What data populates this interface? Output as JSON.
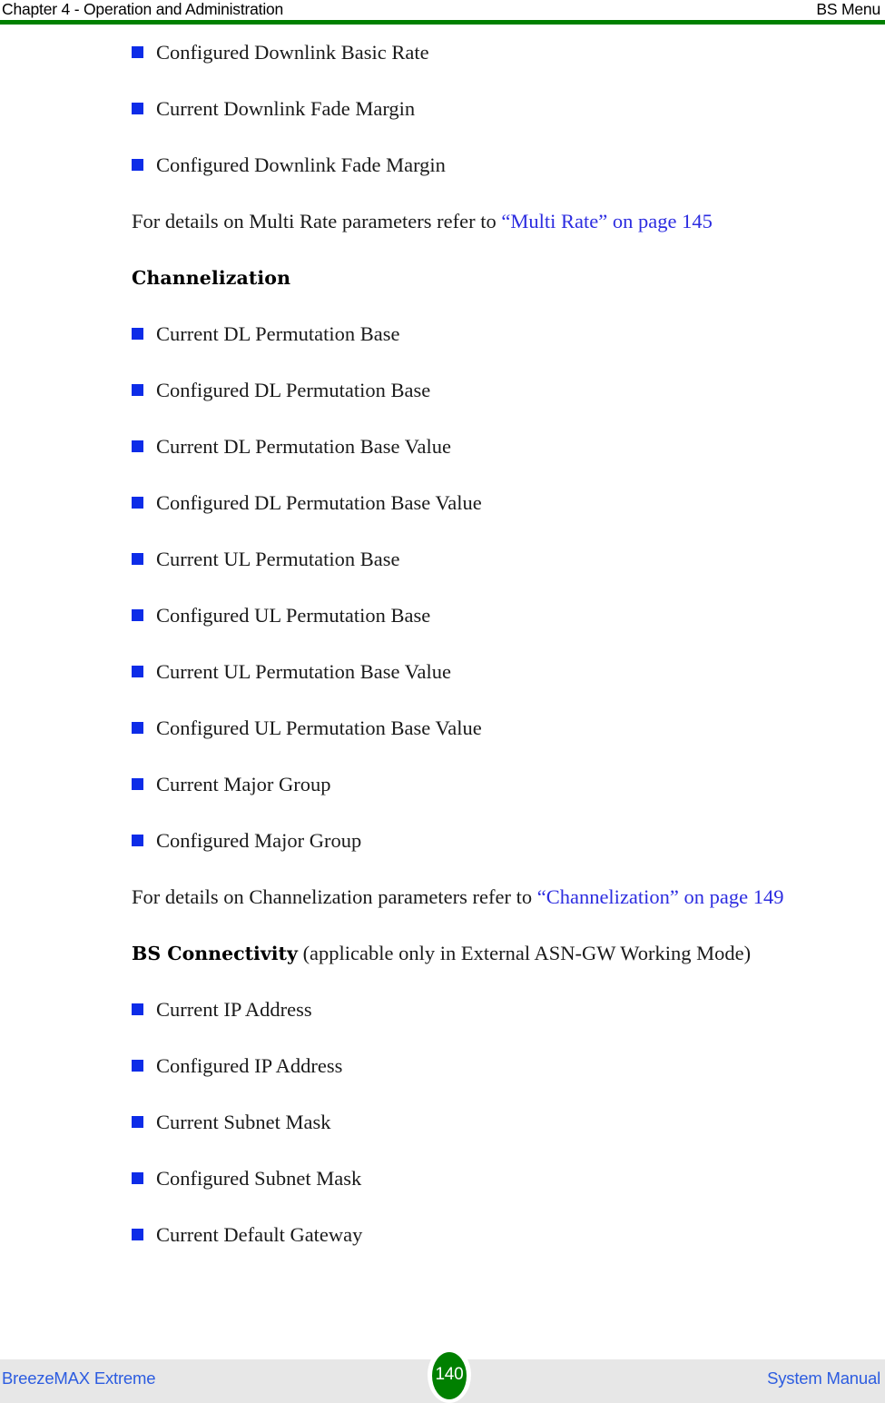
{
  "header": {
    "left_text": "Chapter 4 - Operation and Administration",
    "right_text": "BS Menu",
    "rule_color": "#008000"
  },
  "colors": {
    "bullet_blue": "#0d2ce8",
    "link_blue": "#2c2ce0",
    "footer_text_blue": "#2c5ce0",
    "footer_band": "#e7e7e7",
    "accent_green": "#008000"
  },
  "body": {
    "blocks": [
      {
        "type": "bullet",
        "label": "Configured Downlink Basic Rate"
      },
      {
        "type": "bullet",
        "label": "Current Downlink Fade Margin"
      },
      {
        "type": "bullet",
        "label": "Configured Downlink Fade Margin"
      },
      {
        "type": "xref_paragraph",
        "lead": "For details on Multi Rate parameters refer to ",
        "link": "“Multi Rate” on page 145"
      },
      {
        "type": "heading",
        "label": "Channelization"
      },
      {
        "type": "bullet",
        "label": "Current DL Permutation Base"
      },
      {
        "type": "bullet",
        "label": "Configured DL Permutation Base"
      },
      {
        "type": "bullet",
        "label": "Current DL Permutation Base Value"
      },
      {
        "type": "bullet",
        "label": "Configured DL Permutation Base Value"
      },
      {
        "type": "bullet",
        "label": "Current UL Permutation Base"
      },
      {
        "type": "bullet",
        "label": "Configured UL Permutation Base"
      },
      {
        "type": "bullet",
        "label": "Current UL Permutation Base Value"
      },
      {
        "type": "bullet",
        "label": "Configured UL Permutation Base Value"
      },
      {
        "type": "bullet",
        "label": "Current Major Group"
      },
      {
        "type": "bullet",
        "label": "Configured Major Group"
      },
      {
        "type": "xref_paragraph",
        "lead": "For details on Channelization parameters refer to ",
        "link": "“Channelization” on page 149"
      },
      {
        "type": "heading_inline",
        "strong": "BS Connectivity",
        "rest": " (applicable only in External ASN-GW Working Mode)"
      },
      {
        "type": "bullet",
        "label": "Current IP Address"
      },
      {
        "type": "bullet",
        "label": "Configured IP Address"
      },
      {
        "type": "bullet",
        "label": "Current Subnet Mask"
      },
      {
        "type": "bullet",
        "label": "Configured Subnet Mask"
      },
      {
        "type": "bullet",
        "label": "Current Default Gateway"
      }
    ]
  },
  "footer": {
    "left_text": "BreezeMAX Extreme",
    "page_number": "140",
    "right_text": "System Manual"
  }
}
